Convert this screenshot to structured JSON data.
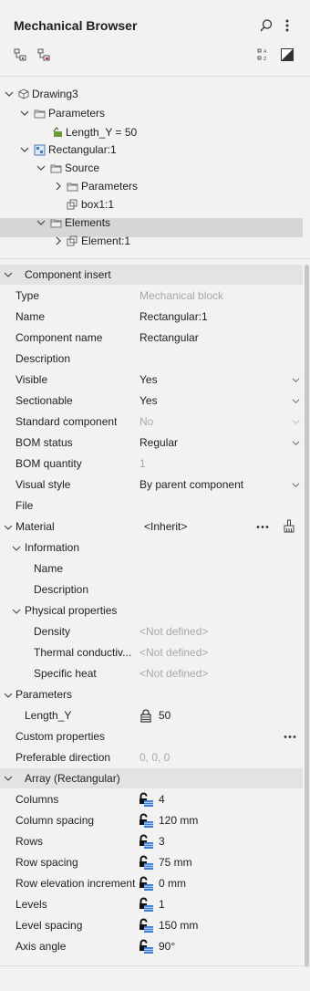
{
  "header": {
    "title": "Mechanical Browser"
  },
  "tree": {
    "drawing": "Drawing3",
    "parameters": "Parameters",
    "length_y": "Length_Y = 50",
    "rectangular": "Rectangular:1",
    "source": "Source",
    "source_parameters": "Parameters",
    "box": "box1:1",
    "elements": "Elements",
    "element": "Element:1"
  },
  "component_insert": {
    "title": "Component insert",
    "rows": [
      {
        "label": "Type",
        "value": "Mechanical block"
      },
      {
        "label": "Name",
        "value": "Rectangular:1"
      },
      {
        "label": "Component name",
        "value": "Rectangular"
      },
      {
        "label": "Description",
        "value": ""
      },
      {
        "label": "Visible",
        "value": "Yes"
      },
      {
        "label": "Sectionable",
        "value": "Yes"
      },
      {
        "label": "Standard component",
        "value": "No"
      },
      {
        "label": "BOM status",
        "value": "Regular"
      },
      {
        "label": "BOM quantity",
        "value": "1"
      },
      {
        "label": "Visual style",
        "value": "By parent component"
      },
      {
        "label": "File",
        "value": ""
      }
    ],
    "material": {
      "label": "Material",
      "value": "<Inherit>"
    },
    "information": {
      "label": "Information",
      "name": "Name",
      "description": "Description"
    },
    "physical": {
      "label": "Physical properties",
      "rows": [
        {
          "label": "Density",
          "value": "<Not defined>"
        },
        {
          "label": "Thermal conductiv...",
          "value": "<Not defined>"
        },
        {
          "label": "Specific heat",
          "value": "<Not defined>"
        }
      ]
    },
    "parameters": {
      "label": "Parameters",
      "param_label": "Length_Y",
      "param_value": "50"
    },
    "custom_properties": "Custom properties",
    "preferable_direction": {
      "label": "Preferable direction",
      "value": "0, 0, 0"
    }
  },
  "array": {
    "title": "Array (Rectangular)",
    "rows": [
      {
        "label": "Columns",
        "value": "4"
      },
      {
        "label": "Column spacing",
        "value": "120 mm"
      },
      {
        "label": "Rows",
        "value": "3"
      },
      {
        "label": "Row spacing",
        "value": "75 mm"
      },
      {
        "label": "Row elevation increment",
        "value": "0 mm"
      },
      {
        "label": "Levels",
        "value": "1"
      },
      {
        "label": "Level spacing",
        "value": "150 mm"
      },
      {
        "label": "Axis angle",
        "value": "90°"
      }
    ]
  },
  "colors": {
    "background": "#f2f2f2",
    "section_bg": "#e3e3e3",
    "selected_bg": "#d6d6d6",
    "dim_text": "#a8a8a8"
  }
}
